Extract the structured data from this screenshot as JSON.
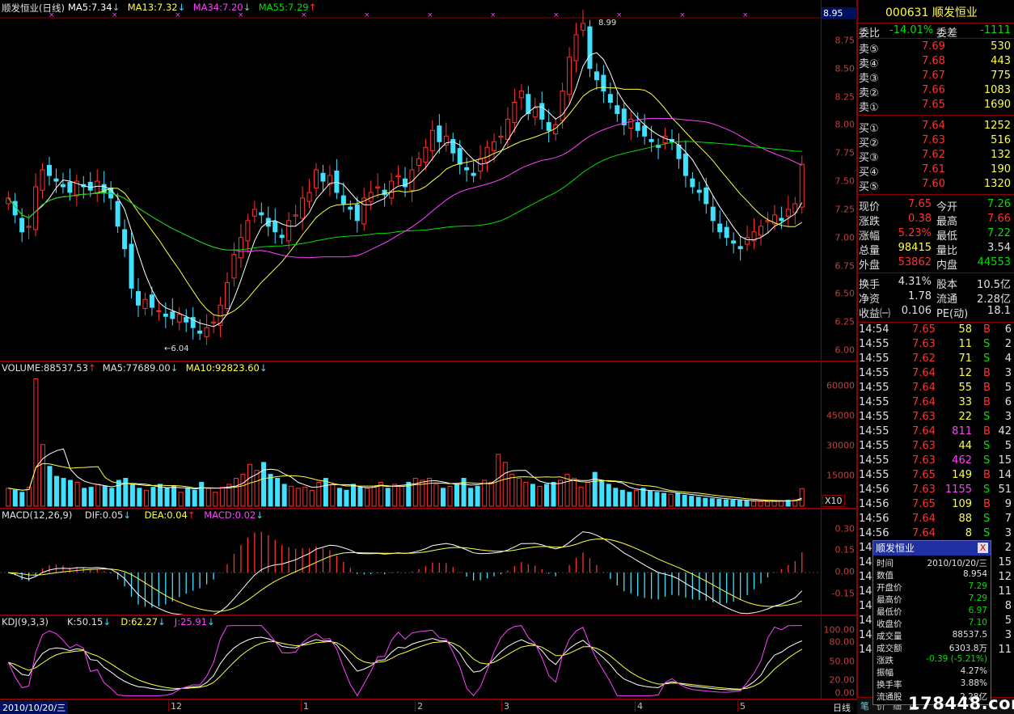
{
  "main_chart": {
    "title": "顺发恒业(日线)",
    "ma": [
      {
        "label": "MA5:7.34",
        "arrow": "↓",
        "color": "#ffffff"
      },
      {
        "label": "MA13:7.32",
        "arrow": "↓",
        "color": "#ffff40"
      },
      {
        "label": "MA34:7.20",
        "arrow": "↓",
        "color": "#ff40ff"
      },
      {
        "label": "MA55:7.29",
        "arrow": "↑",
        "color": "#00e000"
      }
    ],
    "axis": [
      "8.95",
      "8.75",
      "8.50",
      "8.25",
      "8.00",
      "7.75",
      "7.50",
      "7.25",
      "7.00",
      "6.75",
      "6.50",
      "6.25",
      "6.00"
    ],
    "high_label": "8.99",
    "low_label": "6.04"
  },
  "volume_chart": {
    "labels": [
      {
        "label": "VOLUME:88537.53",
        "arrow": "↑",
        "color": "#e0e0e0"
      },
      {
        "label": "MA5:77689.00",
        "arrow": "↓",
        "color": "#e0e0e0"
      },
      {
        "label": "MA10:92823.60",
        "arrow": "↓",
        "color": "#ffff40"
      }
    ],
    "axis": [
      "60000",
      "45000",
      "30000",
      "15000"
    ],
    "unit": "X10"
  },
  "macd_chart": {
    "labels": [
      {
        "label": "MACD(12,26,9)",
        "arrow": "",
        "color": "#e0e0e0"
      },
      {
        "label": "DIF:0.05",
        "arrow": "↓",
        "color": "#e0e0e0"
      },
      {
        "label": "DEA:0.04",
        "arrow": "↑",
        "color": "#ffff40"
      },
      {
        "label": "MACD:0.02",
        "arrow": "↓",
        "color": "#ff40ff"
      }
    ],
    "axis": [
      "0.30",
      "0.15",
      "0.00",
      "-0.15"
    ]
  },
  "kdj_chart": {
    "labels": [
      {
        "label": "KDJ(9,3,3)",
        "arrow": "",
        "color": "#e0e0e0"
      },
      {
        "label": "K:50.15",
        "arrow": "↓",
        "color": "#e0e0e0"
      },
      {
        "label": "D:62.27",
        "arrow": "↓",
        "color": "#ffff40"
      },
      {
        "label": "J:25.91",
        "arrow": "↓",
        "color": "#ff40ff"
      }
    ],
    "axis": [
      "100.00",
      "80.00",
      "50.00",
      "20.00",
      "0.00"
    ]
  },
  "date_axis": {
    "current": "2010/10/20/三",
    "months": [
      "12",
      "1",
      "2",
      "3",
      "4",
      "5"
    ],
    "period": "日线"
  },
  "quote": {
    "code": "000631",
    "name": "顺发恒业",
    "weibi_label": "委比",
    "weibi": "-14.01%",
    "weicha_label": "委差",
    "weicha": "-1111",
    "sells": [
      {
        "label": "卖⑤",
        "price": "7.69",
        "vol": "530"
      },
      {
        "label": "卖④",
        "price": "7.68",
        "vol": "443"
      },
      {
        "label": "卖③",
        "price": "7.67",
        "vol": "775"
      },
      {
        "label": "卖②",
        "price": "7.66",
        "vol": "1083"
      },
      {
        "label": "卖①",
        "price": "7.65",
        "vol": "1690"
      }
    ],
    "buys": [
      {
        "label": "买①",
        "price": "7.64",
        "vol": "1252"
      },
      {
        "label": "买②",
        "price": "7.63",
        "vol": "516"
      },
      {
        "label": "买③",
        "price": "7.62",
        "vol": "132"
      },
      {
        "label": "买④",
        "price": "7.61",
        "vol": "190"
      },
      {
        "label": "买⑤",
        "price": "7.60",
        "vol": "1320"
      }
    ],
    "stats": [
      {
        "l1": "现价",
        "v1": "7.65",
        "c1": "red",
        "l2": "今开",
        "v2": "7.26",
        "c2": "grn"
      },
      {
        "l1": "涨跌",
        "v1": "0.38",
        "c1": "red",
        "l2": "最高",
        "v2": "7.66",
        "c2": "red"
      },
      {
        "l1": "涨幅",
        "v1": "5.23%",
        "c1": "red",
        "l2": "最低",
        "v2": "7.22",
        "c2": "grn"
      },
      {
        "l1": "总量",
        "v1": "98415",
        "c1": "yel",
        "l2": "量比",
        "v2": "3.54",
        "c2": "wht"
      },
      {
        "l1": "外盘",
        "v1": "53862",
        "c1": "red",
        "l2": "内盘",
        "v2": "44553",
        "c2": "grn"
      }
    ],
    "finance": [
      {
        "l1": "换手",
        "v1": "4.31%",
        "l2": "股本",
        "v2": "10.5亿"
      },
      {
        "l1": "净资",
        "v1": "1.78",
        "l2": "流通",
        "v2": "2.28亿"
      },
      {
        "l1": "收益㈠",
        "v1": "0.106",
        "l2": "PE(动)",
        "v2": "18.1"
      }
    ],
    "ticks": [
      {
        "t": "14:54",
        "p": "7.65",
        "v": "58",
        "bs": "B",
        "n": "6"
      },
      {
        "t": "14:55",
        "p": "7.63",
        "v": "11",
        "bs": "S",
        "n": "2"
      },
      {
        "t": "14:55",
        "p": "7.62",
        "v": "71",
        "bs": "S",
        "n": "4"
      },
      {
        "t": "14:55",
        "p": "7.64",
        "v": "12",
        "bs": "B",
        "n": "3"
      },
      {
        "t": "14:55",
        "p": "7.64",
        "v": "55",
        "bs": "B",
        "n": "5"
      },
      {
        "t": "14:55",
        "p": "7.64",
        "v": "33",
        "bs": "B",
        "n": "6"
      },
      {
        "t": "14:55",
        "p": "7.63",
        "v": "22",
        "bs": "S",
        "n": "3"
      },
      {
        "t": "14:55",
        "p": "7.64",
        "v": "811",
        "bs": "B",
        "n": "42"
      },
      {
        "t": "14:55",
        "p": "7.63",
        "v": "44",
        "bs": "S",
        "n": "5"
      },
      {
        "t": "14:55",
        "p": "7.63",
        "v": "462",
        "bs": "S",
        "n": "15"
      },
      {
        "t": "14:55",
        "p": "7.65",
        "v": "149",
        "bs": "B",
        "n": "14"
      },
      {
        "t": "14:56",
        "p": "7.63",
        "v": "1155",
        "bs": "S",
        "n": "51"
      },
      {
        "t": "14:56",
        "p": "7.65",
        "v": "109",
        "bs": "B",
        "n": "9"
      },
      {
        "t": "14:56",
        "p": "7.64",
        "v": "88",
        "bs": "S",
        "n": "7"
      },
      {
        "t": "14:56",
        "p": "7.64",
        "v": "8",
        "bs": "S",
        "n": "3"
      }
    ],
    "tick_stub_right": [
      "2",
      "15",
      "12",
      "11",
      "8",
      "5",
      "3",
      "11"
    ],
    "tabs": [
      "笔",
      "价",
      "细",
      "盘"
    ]
  },
  "popup": {
    "title": "顺发恒业",
    "close": "X",
    "rows": [
      {
        "k": "时间",
        "v": "2010/10/20/三",
        "c": "wht"
      },
      {
        "k": "数值",
        "v": "8.954",
        "c": "wht"
      },
      {
        "k": "开盘价",
        "v": "7.29",
        "c": "grn"
      },
      {
        "k": "最高价",
        "v": "7.29",
        "c": "grn"
      },
      {
        "k": "最低价",
        "v": "6.97",
        "c": "grn"
      },
      {
        "k": "收盘价",
        "v": "7.10",
        "c": "grn"
      },
      {
        "k": "成交量",
        "v": "88537.5",
        "c": "wht"
      },
      {
        "k": "成交额",
        "v": "6303.8万",
        "c": "wht"
      },
      {
        "k": "涨跌",
        "v": "-0.39 (-5.21%)",
        "c": "grn"
      },
      {
        "k": "振幅",
        "v": "4.27%",
        "c": "wht"
      },
      {
        "k": "换手率",
        "v": "3.88%",
        "c": "wht"
      },
      {
        "k": "流通股",
        "v": "2.28亿",
        "c": "wht"
      }
    ]
  },
  "watermark": "178448.com",
  "chart_data": {
    "type": "candlestick",
    "title": "顺发恒业(日线)",
    "ylim": [
      5.95,
      8.95
    ],
    "ma_last": {
      "MA5": 7.34,
      "MA13": 7.32,
      "MA34": 7.2,
      "MA55": 7.29
    },
    "high_marked": 8.99,
    "low_marked": 6.04,
    "close_series": [
      7.35,
      7.2,
      7.05,
      7.1,
      7.45,
      7.6,
      7.55,
      7.5,
      7.45,
      7.4,
      7.5,
      7.45,
      7.42,
      7.5,
      7.4,
      7.35,
      7.1,
      6.9,
      6.55,
      6.4,
      6.45,
      6.38,
      6.35,
      6.3,
      6.28,
      6.32,
      6.25,
      6.2,
      6.15,
      6.2,
      6.25,
      6.4,
      6.6,
      6.85,
      7.0,
      7.15,
      7.25,
      7.2,
      7.1,
      7.05,
      7.0,
      7.15,
      7.2,
      7.35,
      7.4,
      7.6,
      7.5,
      7.55,
      7.4,
      7.3,
      7.25,
      7.15,
      7.35,
      7.4,
      7.45,
      7.38,
      7.5,
      7.55,
      7.45,
      7.6,
      7.7,
      7.8,
      7.95,
      7.85,
      7.9,
      7.75,
      7.65,
      7.6,
      7.55,
      7.7,
      7.8,
      7.85,
      7.9,
      8.05,
      8.2,
      8.3,
      8.1,
      8.15,
      8.05,
      7.95,
      8.0,
      8.3,
      8.6,
      8.8,
      8.9,
      8.5,
      8.4,
      8.3,
      8.2,
      8.1,
      8.0,
      8.05,
      7.95,
      7.9,
      7.85,
      7.8,
      7.9,
      7.85,
      7.7,
      7.55,
      7.45,
      7.4,
      7.3,
      7.15,
      7.05,
      7.0,
      6.95,
      6.9,
      7.0,
      7.05,
      7.1,
      7.15,
      7.2,
      7.15,
      7.25,
      7.3,
      7.65
    ],
    "volume_last": 88537.53,
    "volume_ma": {
      "MA5": 77689.0,
      "MA10": 92823.6
    },
    "volume_ylim": [
      0,
      65000
    ],
    "volume_series": [
      9000,
      8000,
      7000,
      9500,
      64000,
      31000,
      20000,
      15000,
      14000,
      13000,
      12000,
      9000,
      9500,
      11000,
      10000,
      9000,
      13000,
      14000,
      11000,
      9000,
      8000,
      9500,
      11000,
      9000,
      10000,
      7000,
      9000,
      8000,
      12000,
      9000,
      7000,
      9500,
      11000,
      14000,
      16000,
      21000,
      18000,
      22000,
      16000,
      14000,
      11000,
      10000,
      9000,
      9500,
      8000,
      12000,
      14000,
      11000,
      9000,
      8000,
      11000,
      9500,
      9000,
      10000,
      12000,
      9000,
      11000,
      10500,
      12000,
      14000,
      13000,
      14000,
      11000,
      9000,
      10000,
      11000,
      14000,
      9000,
      10000,
      13000,
      12000,
      26000,
      22000,
      16000,
      14000,
      12000,
      11000,
      10000,
      11000,
      12000,
      13000,
      16000,
      14000,
      9500,
      12000,
      17000,
      13000,
      11000,
      9000,
      8000,
      7000,
      8000,
      9000,
      7500,
      7000,
      6500,
      6000,
      6500,
      5500,
      5000,
      4500,
      4000,
      3800,
      3500,
      3200,
      3000,
      2800,
      2600,
      2500,
      2400,
      2300,
      2600,
      2800,
      3000,
      3200,
      8800
    ],
    "macd": {
      "DIF": 0.05,
      "DEA": 0.04,
      "MACD": 0.02,
      "ylim": [
        -0.28,
        0.36
      ]
    },
    "kdj": {
      "K": 50.15,
      "D": 62.27,
      "J": 25.91,
      "ylim": [
        -5,
        110
      ]
    }
  }
}
